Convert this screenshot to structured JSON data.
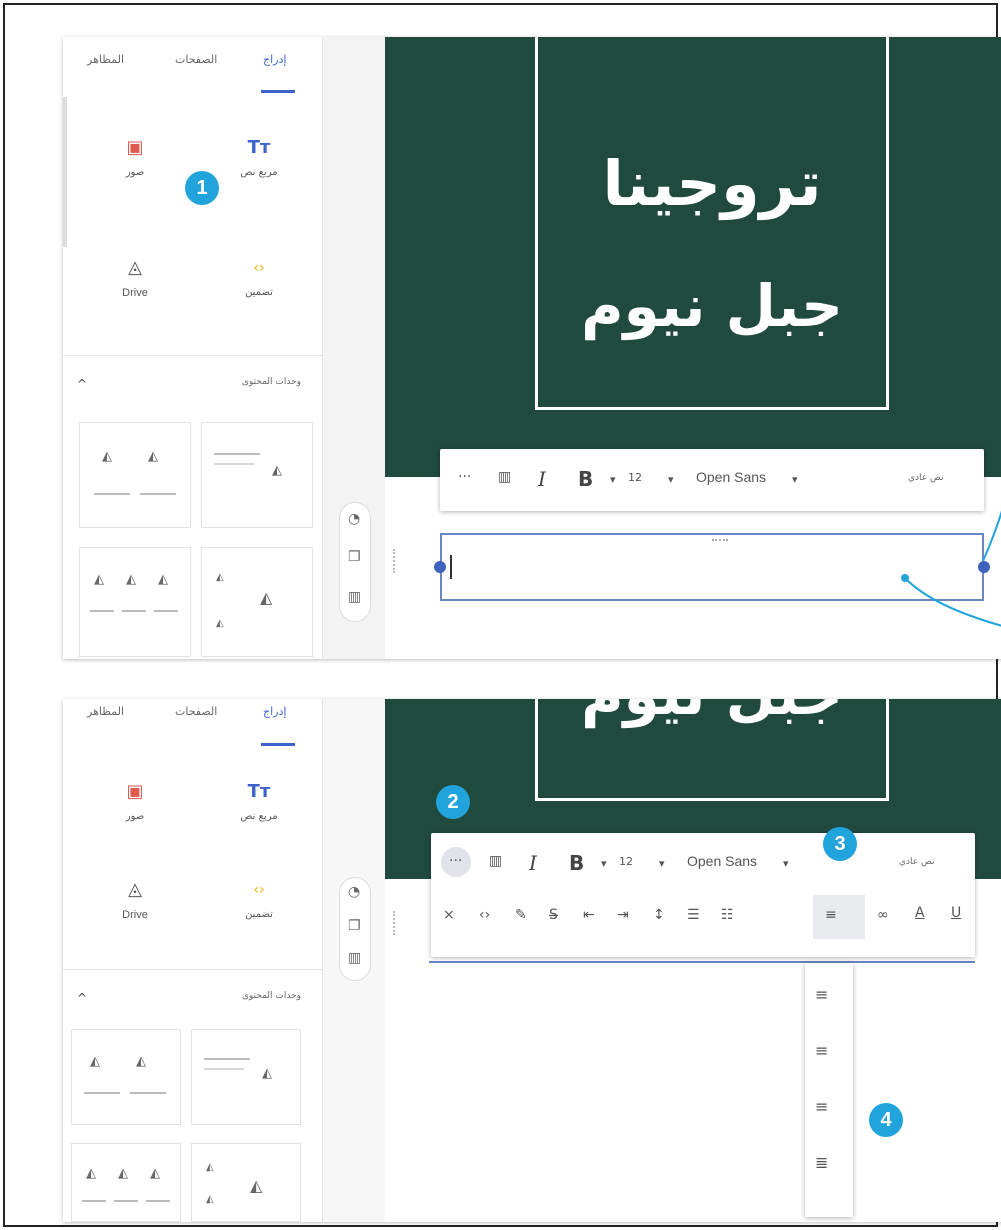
{
  "sidebar": {
    "tabs": [
      {
        "label": "إدراج"
      },
      {
        "label": "الصفحات"
      },
      {
        "label": "المظاهر"
      }
    ],
    "insert_items": [
      {
        "label": "مربع نص",
        "icon": "text-box-icon",
        "glyph": "Tт"
      },
      {
        "label": "صور",
        "icon": "image-icon",
        "glyph": "▣"
      },
      {
        "label": "تضمين",
        "icon": "embed-icon",
        "glyph": "‹›"
      },
      {
        "label": "Drive",
        "icon": "drive-icon",
        "glyph": "◬"
      }
    ],
    "section_title": "وحدات المحتوى",
    "collapse_glyph": "^"
  },
  "slide": {
    "title": "تروجينا جبل نيوم",
    "title_line1": "تروجينا",
    "title_line2": "جبل نيوم",
    "background": "#214a3f"
  },
  "toolbar": {
    "style_label": "نص عادي",
    "font": "Open Sans",
    "size": "12",
    "bold": "B",
    "italic": "I",
    "more": "···"
  },
  "side_tools": [
    "palette-icon",
    "copy-icon",
    "delete-icon"
  ],
  "callouts": [
    "1",
    "2",
    "3",
    "4"
  ],
  "colors": {
    "accent": "#3b63c9",
    "callout": "#21a3dc",
    "slide_bg": "#214a3f"
  }
}
